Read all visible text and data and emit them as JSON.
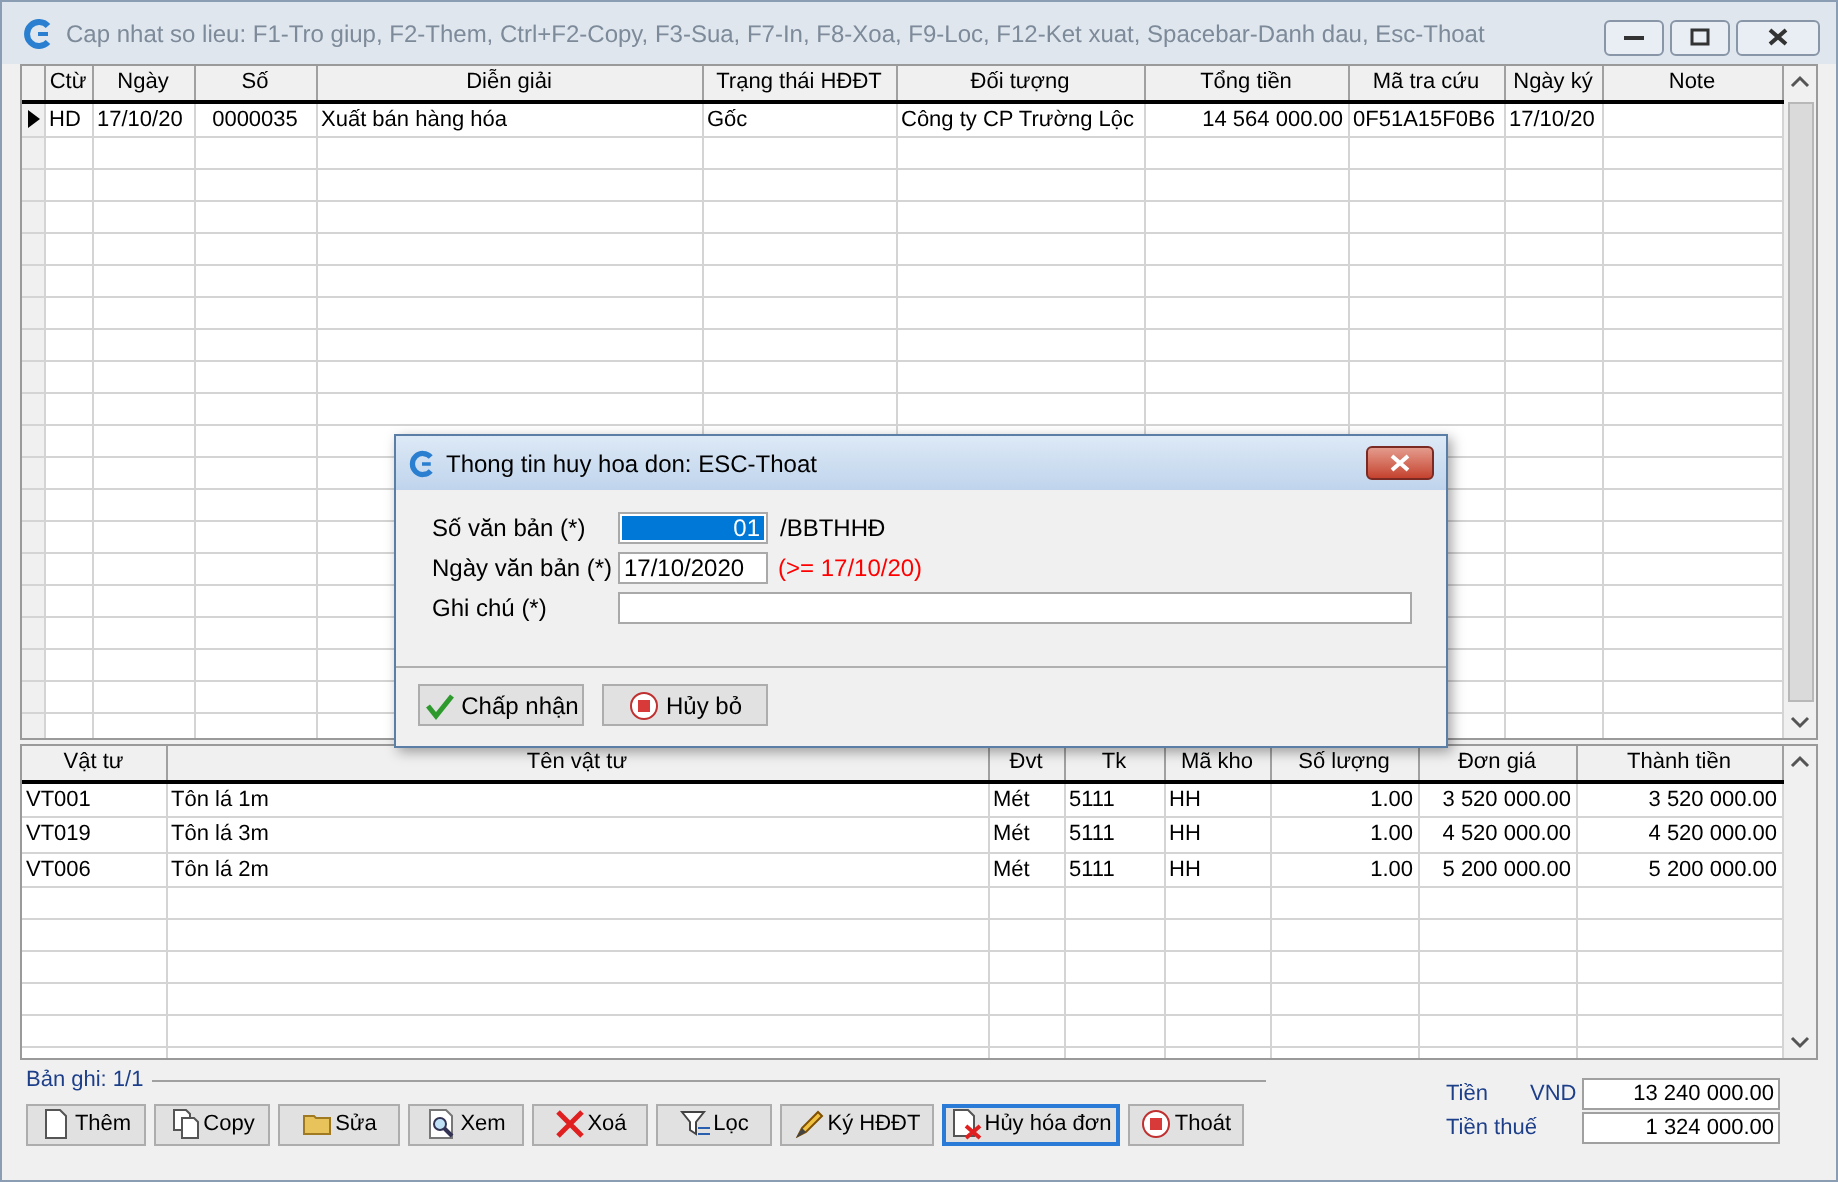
{
  "window": {
    "title": "Cap nhat so lieu: F1-Tro giup, F2-Them, Ctrl+F2-Copy, F3-Sua, F7-In, F8-Xoa, F9-Loc, F12-Ket xuat, Spacebar-Danh dau, Esc-Thoat"
  },
  "invoices": {
    "columns": [
      {
        "label": "Ctừ",
        "kind": "text"
      },
      {
        "label": "Ngày",
        "kind": "text"
      },
      {
        "label": "Số",
        "kind": "code"
      },
      {
        "label": "Diễn giải",
        "kind": "text"
      },
      {
        "label": "Trạng thái HĐĐT",
        "kind": "text"
      },
      {
        "label": "Đối tượng",
        "kind": "text"
      },
      {
        "label": "Tổng tiền",
        "kind": "number"
      },
      {
        "label": "Mã tra cứu",
        "kind": "text"
      },
      {
        "label": "Ngày ký",
        "kind": "text"
      },
      {
        "label": "Note",
        "kind": "text"
      }
    ],
    "rows": [
      {
        "selected": true,
        "cells": [
          "HD",
          "17/10/20",
          "0000035",
          "Xuất bán hàng hóa",
          "Gốc",
          "Công ty CP Trường Lộc",
          "14 564 000.00",
          "0F51A15F0B6",
          "17/10/20",
          ""
        ]
      }
    ]
  },
  "items": {
    "columns": [
      {
        "label": "Vật tư",
        "kind": "text"
      },
      {
        "label": "Tên vật tư",
        "kind": "text"
      },
      {
        "label": "Đvt",
        "kind": "text"
      },
      {
        "label": "Tk",
        "kind": "text"
      },
      {
        "label": "Mã kho",
        "kind": "text"
      },
      {
        "label": "Số lượng",
        "kind": "number"
      },
      {
        "label": "Đơn giá",
        "kind": "number"
      },
      {
        "label": "Thành tiền",
        "kind": "number"
      }
    ],
    "rows": [
      {
        "cells": [
          "VT001",
          "Tôn lá 1m",
          "Mét",
          "5111",
          "HH",
          "1.00",
          "3 520 000.00",
          "3 520 000.00"
        ]
      },
      {
        "cells": [
          "VT019",
          "Tôn lá 3m",
          "Mét",
          "5111",
          "HH",
          "1.00",
          "4 520 000.00",
          "4 520 000.00"
        ]
      },
      {
        "cells": [
          "VT006",
          "Tôn lá 2m",
          "Mét",
          "5111",
          "HH",
          "1.00",
          "5 200 000.00",
          "5 200 000.00"
        ]
      }
    ]
  },
  "record_count": "Bản ghi: 1/1",
  "buttons": [
    {
      "label": "Thêm",
      "focused": false
    },
    {
      "label": "Copy",
      "focused": false
    },
    {
      "label": "Sửa",
      "focused": false
    },
    {
      "label": "Xem",
      "focused": false
    },
    {
      "label": "Xoá",
      "focused": false
    },
    {
      "label": "Lọc",
      "focused": false
    },
    {
      "label": "Ký HĐĐT",
      "focused": false
    },
    {
      "label": "Hủy hóa đơn",
      "focused": true
    },
    {
      "label": "Thoát",
      "focused": false
    }
  ],
  "totals": [
    {
      "label": "Tiền",
      "currency": "VND",
      "value": "13 240 000.00"
    },
    {
      "label": "Tiền thuế",
      "value": "1 324 000.00"
    }
  ],
  "dialog": {
    "title": "Thong tin huy hoa don: ESC-Thoat",
    "fields": [
      {
        "label": "Số văn bản (*)",
        "kind": "short",
        "value": "01",
        "text_selected": true,
        "suffix": "/BBTHHĐ"
      },
      {
        "label": "Ngày văn bản (*)",
        "kind": "short",
        "value": "17/10/2020",
        "text_selected": false,
        "hint": "(>= 17/10/20)"
      },
      {
        "label": "Ghi chú (*)",
        "kind": "wide"
      }
    ],
    "buttons": [
      {
        "label": "Chấp nhận"
      },
      {
        "label": "Hủy bỏ"
      }
    ]
  }
}
